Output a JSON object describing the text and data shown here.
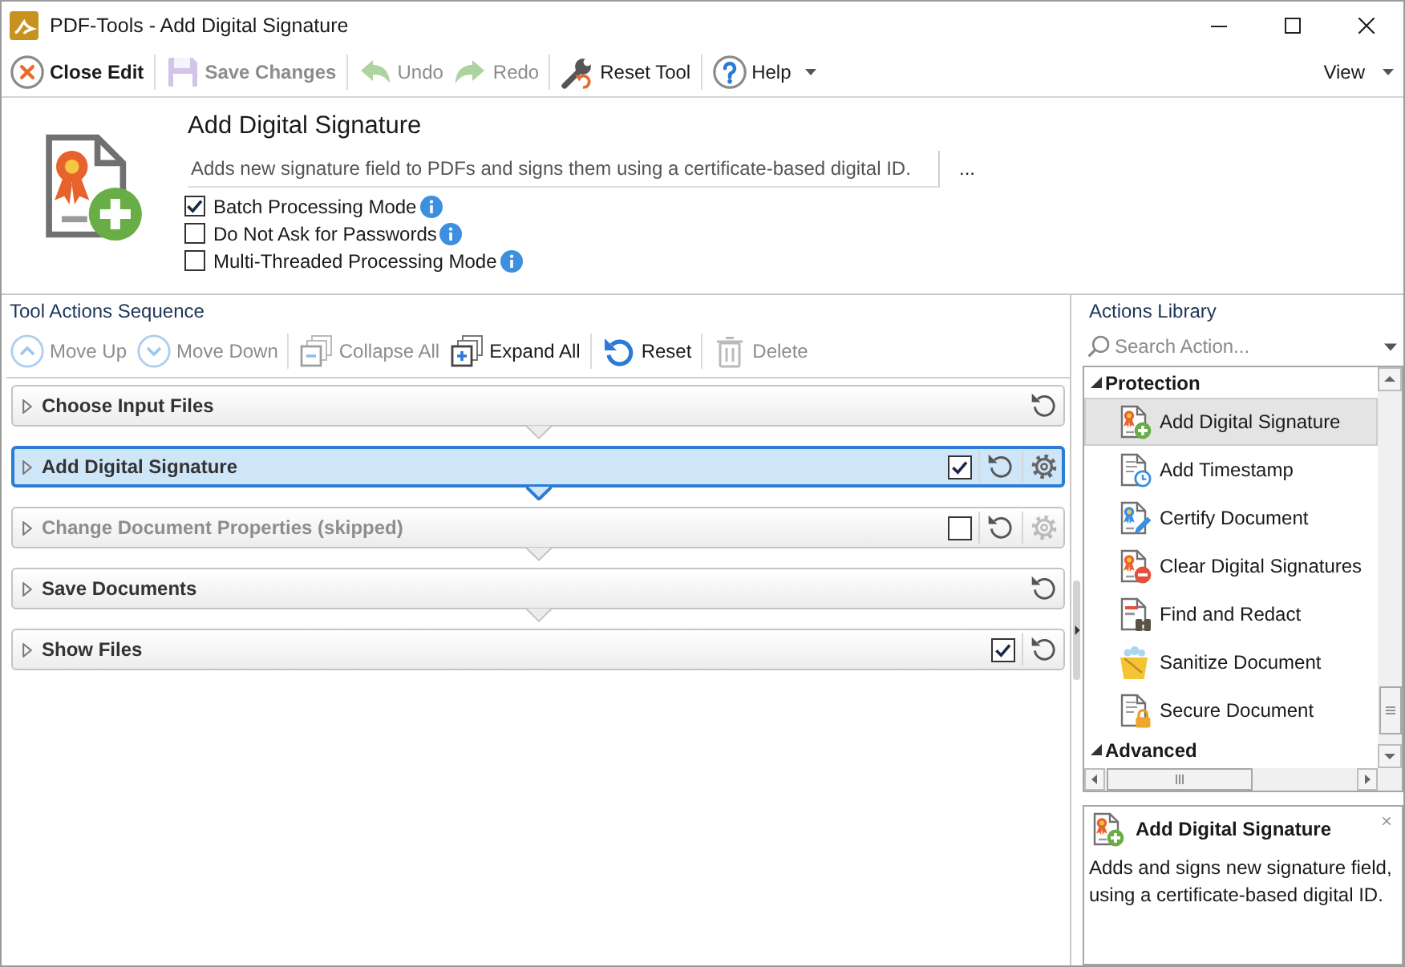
{
  "window": {
    "title": "PDF-Tools - Add Digital Signature"
  },
  "toolbar": {
    "groups": [
      {
        "items": [
          {
            "kind": "close",
            "label": "Close Edit",
            "disabled": false,
            "dropdown": false
          }
        ]
      },
      {
        "items": [
          {
            "kind": "save",
            "label": "Save Changes",
            "disabled": true,
            "dropdown": false
          }
        ]
      },
      {
        "items": [
          {
            "kind": "undo",
            "label": "Undo",
            "disabled": true,
            "dropdown": false
          },
          {
            "kind": "redo",
            "label": "Redo",
            "disabled": true,
            "dropdown": false
          }
        ]
      },
      {
        "items": [
          {
            "kind": "reset-tool",
            "label": "Reset Tool",
            "disabled": false,
            "dropdown": false
          }
        ]
      },
      {
        "items": [
          {
            "kind": "help",
            "label": "Help",
            "disabled": false,
            "dropdown": true
          }
        ]
      }
    ],
    "view": {
      "label": "View",
      "dropdown": true
    }
  },
  "tool": {
    "title": "Add Digital Signature",
    "description": "Adds new signature field to PDFs and signs them using a certificate-based digital ID.",
    "more_button": "...",
    "options": [
      {
        "label": "Batch Processing Mode",
        "checked": true
      },
      {
        "label": "Do Not Ask for Passwords",
        "checked": false
      },
      {
        "label": "Multi-Threaded Processing Mode",
        "checked": false
      }
    ]
  },
  "sequence": {
    "title": "Tool Actions Sequence",
    "toolbar": {
      "groups": [
        {
          "items": [
            {
              "kind": "move-up",
              "label": "Move Up",
              "disabled": true
            },
            {
              "kind": "move-down",
              "label": "Move Down",
              "disabled": true
            }
          ]
        },
        {
          "items": [
            {
              "kind": "collapse-all",
              "label": "Collapse All",
              "disabled": true
            },
            {
              "kind": "expand-all",
              "label": "Expand All",
              "disabled": false
            }
          ]
        },
        {
          "items": [
            {
              "kind": "reset",
              "label": "Reset",
              "disabled": false
            }
          ]
        },
        {
          "items": [
            {
              "kind": "delete",
              "label": "Delete",
              "disabled": true
            }
          ]
        }
      ]
    },
    "actions": [
      {
        "kind": "fixed",
        "title": "Choose Input Files",
        "selected": false,
        "checked": true,
        "expanded": false
      },
      {
        "kind": "configurable",
        "title": "Add Digital Signature",
        "selected": true,
        "checked": true,
        "expanded": false
      },
      {
        "kind": "configurable",
        "title": "Change Document Properties (skipped)",
        "selected": false,
        "checked": false,
        "expanded": false
      },
      {
        "kind": "fixed",
        "title": "Save Documents",
        "selected": false,
        "checked": true,
        "expanded": false
      },
      {
        "kind": "optional",
        "title": "Show Files",
        "selected": false,
        "checked": true,
        "expanded": false
      }
    ]
  },
  "library": {
    "title": "Actions Library",
    "search": {
      "placeholder": "Search Action..."
    },
    "tree": [
      {
        "label": "Protection",
        "expanded": true,
        "children": [
          {
            "kind": "add-signature",
            "label": "Add Digital Signature",
            "selected": true
          },
          {
            "kind": "timestamp",
            "label": "Add Timestamp",
            "selected": false
          },
          {
            "kind": "certify",
            "label": "Certify Document",
            "selected": false
          },
          {
            "kind": "clear-signatures",
            "label": "Clear Digital Signatures",
            "selected": false
          },
          {
            "kind": "redact",
            "label": "Find and Redact",
            "selected": false
          },
          {
            "kind": "sanitize",
            "label": "Sanitize Document",
            "selected": false
          },
          {
            "kind": "secure",
            "label": "Secure Document",
            "selected": false
          }
        ]
      },
      {
        "label": "Advanced",
        "expanded": true
      }
    ]
  },
  "details": {
    "kind": "add-signature",
    "title": "Add Digital Signature",
    "description": "Adds and signs new signature field, using a certificate-based digital ID.",
    "close": "×"
  }
}
